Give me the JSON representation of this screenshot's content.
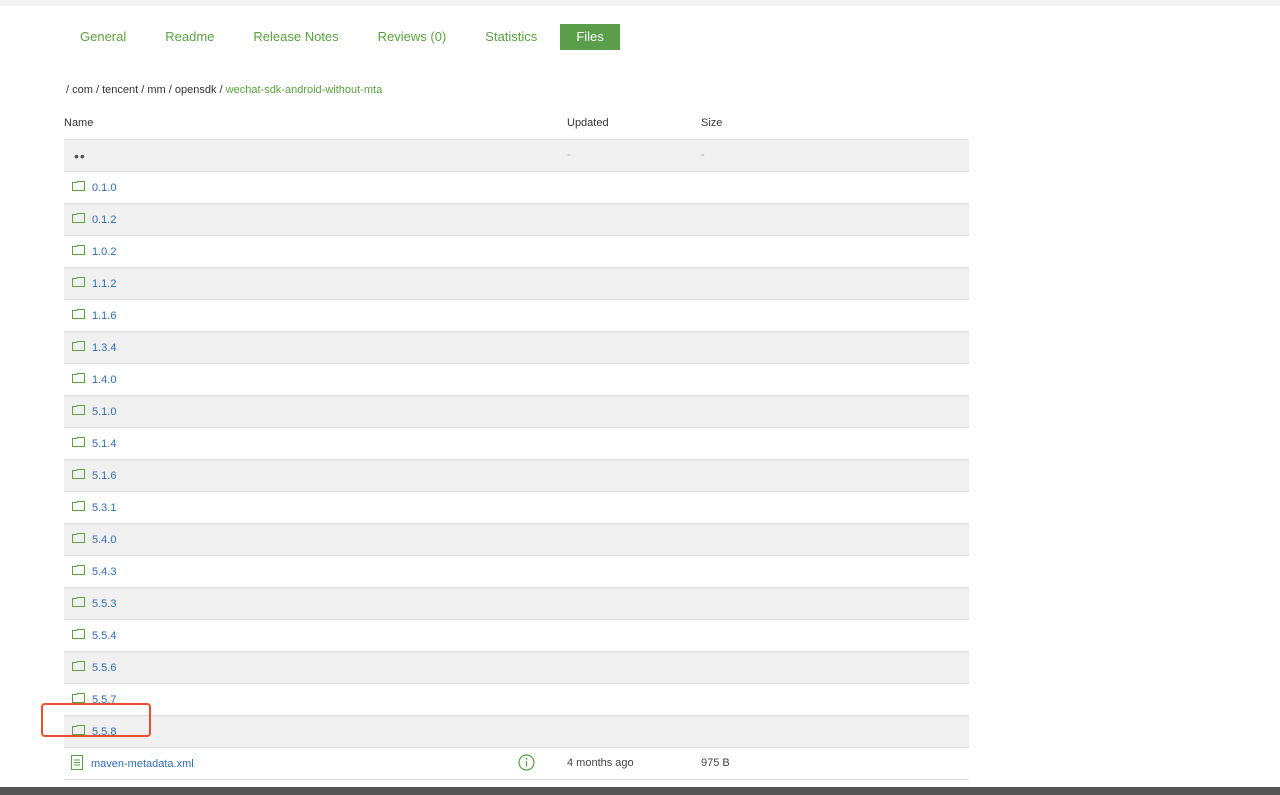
{
  "tabs": [
    {
      "label": "General"
    },
    {
      "label": "Readme"
    },
    {
      "label": "Release Notes"
    },
    {
      "label": "Reviews (0)"
    },
    {
      "label": "Statistics"
    },
    {
      "label": "Files",
      "active": true
    }
  ],
  "breadcrumb": {
    "separator": "/",
    "items": [
      "com",
      "tencent",
      "mm",
      "opensdk"
    ],
    "current": "wechat-sdk-android-without-mta"
  },
  "table": {
    "headers": {
      "name": "Name",
      "updated": "Updated",
      "size": "Size"
    },
    "parent_row": {
      "updated": "-",
      "size": "-"
    },
    "folders": [
      "0.1.0",
      "0.1.2",
      "1.0.2",
      "1.1.2",
      "1.1.6",
      "1.3.4",
      "1.4.0",
      "5.1.0",
      "5.1.4",
      "5.1.6",
      "5.3.1",
      "5.4.0",
      "5.4.3",
      "5.5.3",
      "5.5.4",
      "5.5.6",
      "5.5.7",
      "5.5.8"
    ],
    "file": {
      "name": "maven-metadata.xml",
      "updated": "4 months ago",
      "size": "975 B",
      "icon": "document-icon",
      "info_icon": "info-icon"
    }
  },
  "colors": {
    "accent": "#5aa13f",
    "active_tab_bg": "#5a9e4b",
    "link": "#2f6db3",
    "highlight": "#e8502f"
  },
  "icons": {
    "folder": "folder-icon",
    "parent": "parent-dots-icon"
  }
}
